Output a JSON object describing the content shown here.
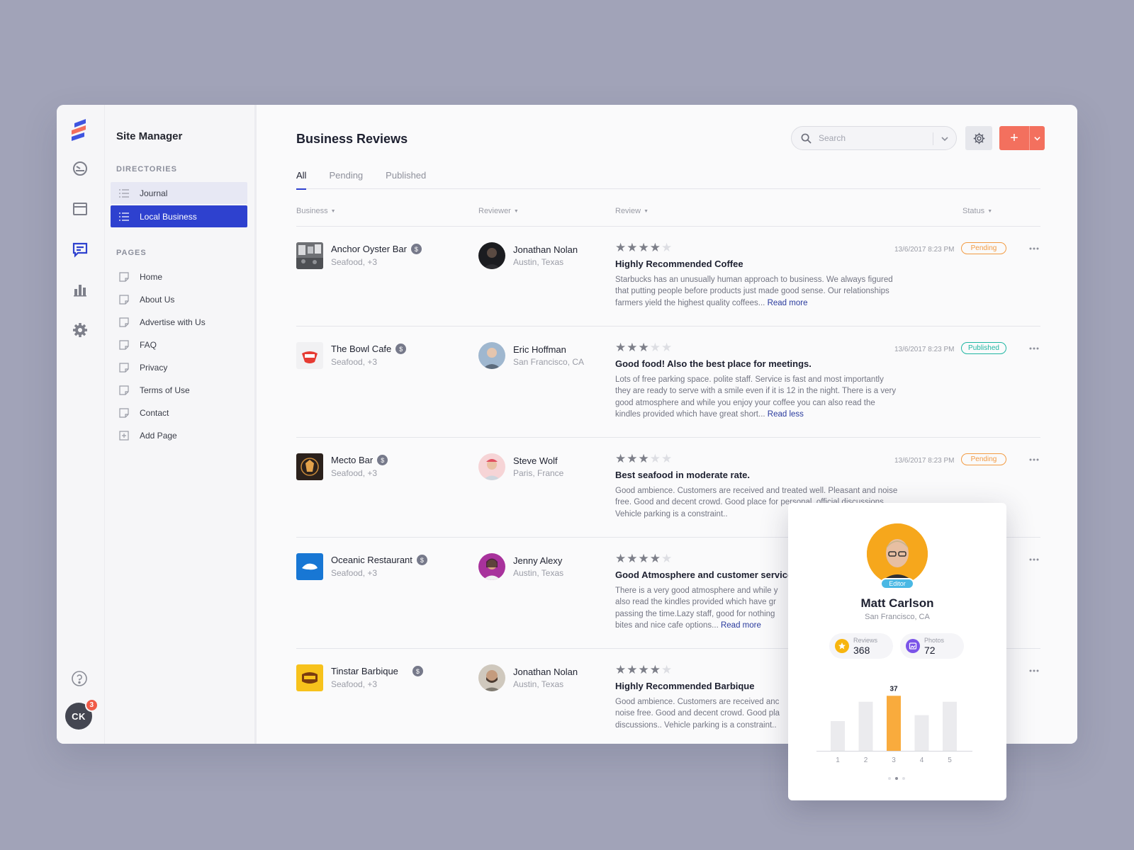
{
  "sidebar": {
    "title": "Site Manager",
    "directories_heading": "DIRECTORIES",
    "directories": [
      "Journal",
      "Local Business"
    ],
    "pages_heading": "PAGES",
    "pages": [
      "Home",
      "About Us",
      "Advertise with Us",
      "FAQ",
      "Privacy",
      "Terms of Use",
      "Contact",
      "Add Page"
    ]
  },
  "user": {
    "initials": "CK",
    "notifications": "3"
  },
  "header": {
    "title": "Business Reviews",
    "search_placeholder": "Search"
  },
  "tabs": [
    "All",
    "Pending",
    "Published"
  ],
  "columns": {
    "business": "Business",
    "reviewer": "Reviewer",
    "review": "Review",
    "status": "Status"
  },
  "reviews": [
    {
      "business": "Anchor Oyster Bar",
      "business_sub": "Seafood, +3",
      "reviewer": "Jonathan Nolan",
      "reviewer_loc": "Austin, Texas",
      "rating": 4,
      "title": "Highly Recommended Coffee",
      "body": "Starbucks has an unusually human approach to business. We always figured that putting people before products just made good sense. Our relationships farmers yield the highest quality coffees...",
      "link": "Read more",
      "date": "13/6/2017 8:23 PM",
      "status": "Pending"
    },
    {
      "business": "The Bowl Cafe",
      "business_sub": "Seafood, +3",
      "reviewer": "Eric Hoffman",
      "reviewer_loc": "San Francisco, CA",
      "rating": 3,
      "title": "Good food! Also the best place for meetings.",
      "body": "Lots of free parking space. polite staff. Service is fast and most importantly they are ready to serve with a smile even if it is 12 in the night. There is a very good atmosphere and while you enjoy your coffee you can also read the kindles provided which have great short...",
      "link": "Read less",
      "date": "13/6/2017 8:23 PM",
      "status": "Published"
    },
    {
      "business": "Mecto Bar",
      "business_sub": "Seafood, +3",
      "reviewer": "Steve Wolf",
      "reviewer_loc": "Paris, France",
      "rating": 3,
      "title": "Best seafood in moderate rate.",
      "body": "Good ambience. Customers are received and treated well. Pleasant and noise free. Good and decent crowd. Good place for personal, official discussions.. Vehicle parking is a constraint..",
      "link": "",
      "date": "13/6/2017 8:23 PM",
      "status": "Pending"
    },
    {
      "business": "Oceanic Restaurant",
      "business_sub": "Seafood, +3",
      "reviewer": "Jenny Alexy",
      "reviewer_loc": "Austin, Texas",
      "rating": 4,
      "title": "Good Atmosphere and customer service",
      "body": "There is a very good atmosphere and while y also read the kindles provided which have gr passing the time.Lazy staff, good for nothing bites and nice cafe options...",
      "link": "Read more",
      "date": "",
      "status": ""
    },
    {
      "business": "Tinstar Barbique",
      "business_sub": "Seafood, +3",
      "reviewer": "Jonathan Nolan",
      "reviewer_loc": "Austin, Texas",
      "rating": 4,
      "title": "Highly Recommended Barbique",
      "body": "Good ambience. Customers are received anc noise free. Good and decent crowd. Good pla discussions.. Vehicle parking is a constraint..",
      "link": "",
      "date": "",
      "status": ""
    }
  ],
  "profile": {
    "name": "Matt Carlson",
    "location": "San Francisco, CA",
    "role": "Editor",
    "reviews_label": "Reviews",
    "reviews": "368",
    "photos_label": "Photos",
    "photos": "72"
  },
  "chart_data": {
    "type": "bar",
    "categories": [
      "1",
      "2",
      "3",
      "4",
      "5"
    ],
    "values": [
      20,
      33,
      37,
      24,
      33
    ],
    "highlight_index": 2,
    "data_labels": [
      "",
      "",
      "37",
      "",
      ""
    ],
    "ylim": [
      0,
      40
    ],
    "colors": {
      "bar": "#ebebee",
      "highlight": "#f9ab3d"
    },
    "title": "",
    "xlabel": "",
    "ylabel": ""
  },
  "colors": {
    "primary": "#2e41cf",
    "accent": "#f3705e",
    "pending": "#f29b43",
    "published": "#1fb6a2"
  }
}
